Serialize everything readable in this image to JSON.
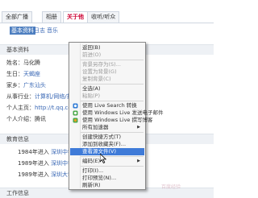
{
  "tabs": [
    {
      "label": "全部广播"
    },
    {
      "label": "相册"
    },
    {
      "label": "关于他"
    },
    {
      "label": "收听/听众"
    }
  ],
  "subnav": {
    "active": "基本资料",
    "items": [
      "日志",
      "音乐"
    ]
  },
  "basic": {
    "section_title": "基本资料",
    "rows": [
      {
        "label": "姓名：",
        "value": "马化腾",
        "link": false
      },
      {
        "label": "生日：",
        "value": "天蝎座",
        "link": true
      },
      {
        "label": "家乡：",
        "value": "广东汕头",
        "link": true
      },
      {
        "label": "从事行业：",
        "value": "计算机/网络/技术",
        "link": true
      },
      {
        "label": "个人主页：",
        "value": "http://t.qq.com",
        "link": true
      },
      {
        "label": "个人介绍：",
        "value": "腾讯",
        "link": false
      }
    ]
  },
  "education": {
    "section_title": "教育信息",
    "rows": [
      {
        "year": "1984年进入",
        "school": "深圳中学",
        "unit": "高中"
      },
      {
        "year": "1989年进入",
        "school": "深圳中学",
        "unit": "高中"
      },
      {
        "year": "1989年进入",
        "school": "深圳大学",
        "unit": ""
      }
    ]
  },
  "work": {
    "section_title": "工作信息"
  },
  "context_menu": {
    "items": [
      {
        "label": "返回(B)",
        "disabled": false
      },
      {
        "label": "前进(O)",
        "disabled": true
      },
      {
        "sep": true
      },
      {
        "label": "背景另存为(S)...",
        "disabled": true
      },
      {
        "label": "设置为背景(G)",
        "disabled": true
      },
      {
        "label": "复制背景(C)",
        "disabled": true
      },
      {
        "sep": true
      },
      {
        "label": "全选(A)",
        "disabled": false
      },
      {
        "label": "粘贴(P)",
        "disabled": true
      },
      {
        "sep": true
      },
      {
        "label": "使用 Live Search 转换",
        "disabled": false,
        "icon": "live-search-icon"
      },
      {
        "label": "使用 Windows Live 发送电子邮件",
        "disabled": false,
        "icon": "windows-live-mail-icon"
      },
      {
        "label": "使用 Windows Live 撰写博客",
        "disabled": false,
        "icon": "windows-live-blog-icon"
      },
      {
        "label": "所有加速器",
        "disabled": false,
        "submenu": true
      },
      {
        "sep": true
      },
      {
        "label": "创建快捷方式(T)",
        "disabled": false
      },
      {
        "label": "添加到收藏夹(F)...",
        "disabled": false
      },
      {
        "label": "查看源文件(V)",
        "disabled": false,
        "highlighted": true
      },
      {
        "sep": true
      },
      {
        "label": "编码(E)",
        "disabled": false,
        "submenu": true
      },
      {
        "sep": true
      },
      {
        "label": "打印(I)...",
        "disabled": false
      },
      {
        "label": "打印预览(N)...",
        "disabled": false
      },
      {
        "label": "刷新(R)",
        "disabled": false
      }
    ]
  },
  "colors": {
    "highlight": "#3f7bd8",
    "link": "#3a68b5",
    "active_tab": "#cc0033"
  },
  "watermark": "百度经验"
}
